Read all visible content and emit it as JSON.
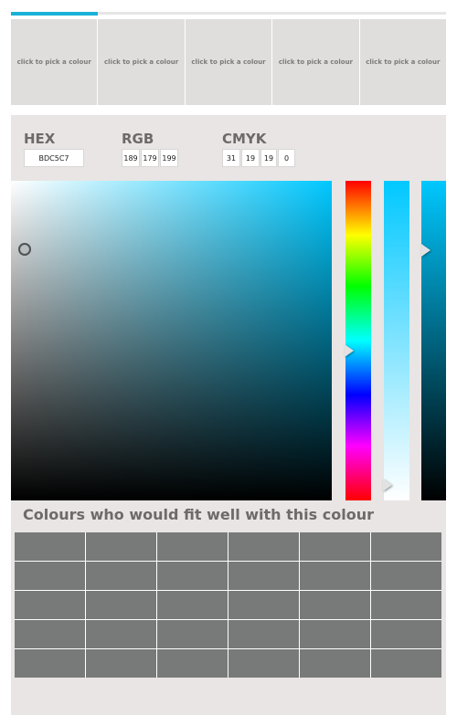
{
  "top_tabs": {
    "active_color": "#1ab1d6"
  },
  "swatches": [
    {
      "label": "click to pick a colour"
    },
    {
      "label": "click to pick a colour"
    },
    {
      "label": "click to pick a colour"
    },
    {
      "label": "click to pick a colour"
    },
    {
      "label": "click to pick a colour"
    }
  ],
  "formats": {
    "hex": {
      "title": "HEX",
      "value": "BDC5C7"
    },
    "rgb": {
      "title": "RGB",
      "r": "189",
      "g": "179",
      "b": "199"
    },
    "cmyk": {
      "title": "CMYK",
      "c": "31",
      "m": "19",
      "y": "19",
      "k": "0"
    }
  },
  "picker": {
    "base_hue_color": "#00c8ff"
  },
  "suggestions": {
    "title": "Colours who would fit well with this colour",
    "cell_color": "#787a79",
    "rows": 5,
    "cols": 6
  }
}
